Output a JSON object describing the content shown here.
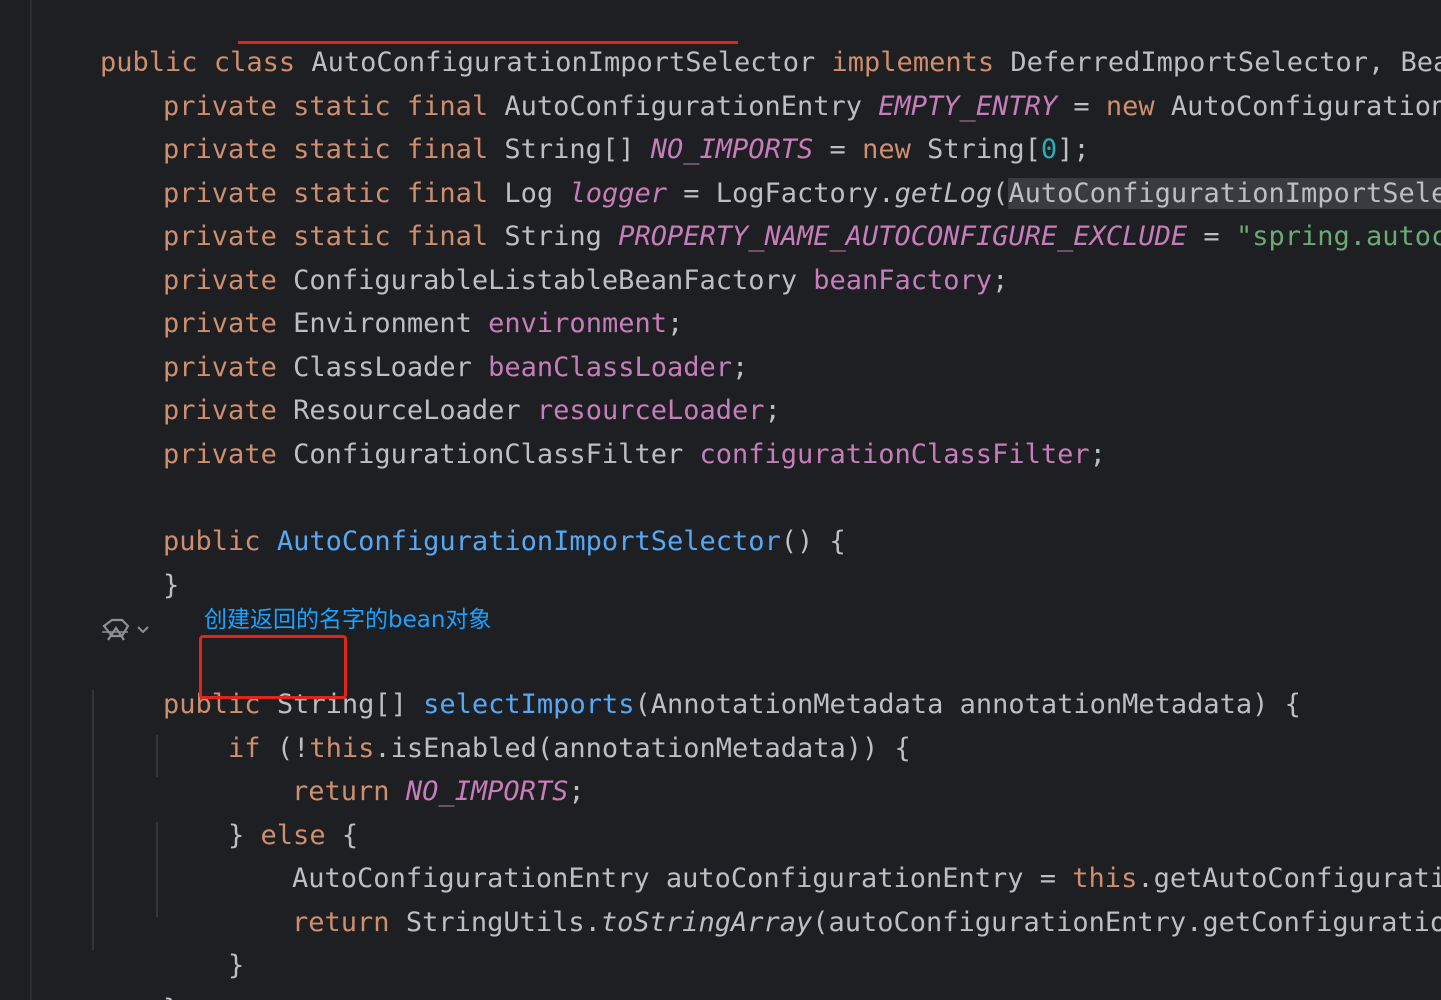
{
  "annotation": {
    "text": "创建返回的名字的bean对象",
    "highlight_color": "#e1251b",
    "text_color": "#1ea0ff"
  },
  "gutter": {
    "icon": "implementation-marker-icon",
    "chevron": "chevron-down-icon"
  },
  "code": {
    "l1": {
      "a": "public class ",
      "b": "AutoConfigurationImportSelector",
      "c": " implements ",
      "d": "DeferredImportSelector, BeanClas"
    },
    "l2": {
      "a": "private static final ",
      "b": "AutoConfigurationEntry ",
      "c": "EMPTY_ENTRY",
      "d": " = ",
      "e": "new ",
      "f": "AutoConfigurationEntry"
    },
    "l3": {
      "a": "private static final ",
      "b": "String[] ",
      "c": "NO_IMPORTS",
      "d": " = ",
      "e": "new ",
      "f": "String[",
      "g": "0",
      "h": "];"
    },
    "l4": {
      "a": "private static final ",
      "b": "Log ",
      "c": "logger",
      "d": " = LogFactory.",
      "e": "getLog",
      "f": "(",
      "g": "AutoConfigurationImportSelector",
      "h": "."
    },
    "l5": {
      "a": "private static final ",
      "b": "String ",
      "c": "PROPERTY_NAME_AUTOCONFIGURE_EXCLUDE",
      "d": " = ",
      "e": "\"spring.autoconfig"
    },
    "l6": {
      "a": "private ",
      "b": "ConfigurableListableBeanFactory ",
      "c": "beanFactory",
      "d": ";"
    },
    "l7": {
      "a": "private ",
      "b": "Environment ",
      "c": "environment",
      "d": ";"
    },
    "l8": {
      "a": "private ",
      "b": "ClassLoader ",
      "c": "beanClassLoader",
      "d": ";"
    },
    "l9": {
      "a": "private ",
      "b": "ResourceLoader ",
      "c": "resourceLoader",
      "d": ";"
    },
    "l10": {
      "a": "private ",
      "b": "ConfigurationClassFilter ",
      "c": "configurationClassFilter",
      "d": ";"
    },
    "l11": {
      "a": "public ",
      "b": "AutoConfigurationImportSelector",
      "c": "() {"
    },
    "l12": {
      "a": "}"
    },
    "l13": {
      "a": "public ",
      "b": "String[]",
      "c": " ",
      "d": "selectImports",
      "e": "(AnnotationMetadata annotationMetadata) {"
    },
    "l14": {
      "a": "if ",
      "b": "(!",
      "c": "this",
      "d": ".isEnabled(annotationMetadata)) {"
    },
    "l15": {
      "a": "return ",
      "b": "NO_IMPORTS",
      "c": ";"
    },
    "l16": {
      "a": "} ",
      "b": "else",
      "c": " {"
    },
    "l17": {
      "a": "AutoConfigurationEntry autoConfigurationEntry = ",
      "b": "this",
      "c": ".getAutoConfigurationEnt"
    },
    "l18": {
      "a": "return ",
      "b": "StringUtils.",
      "c": "toStringArray",
      "d": "(autoConfigurationEntry.getConfigurations())"
    },
    "l19": {
      "a": "}"
    },
    "l20": {
      "a": "}"
    }
  }
}
